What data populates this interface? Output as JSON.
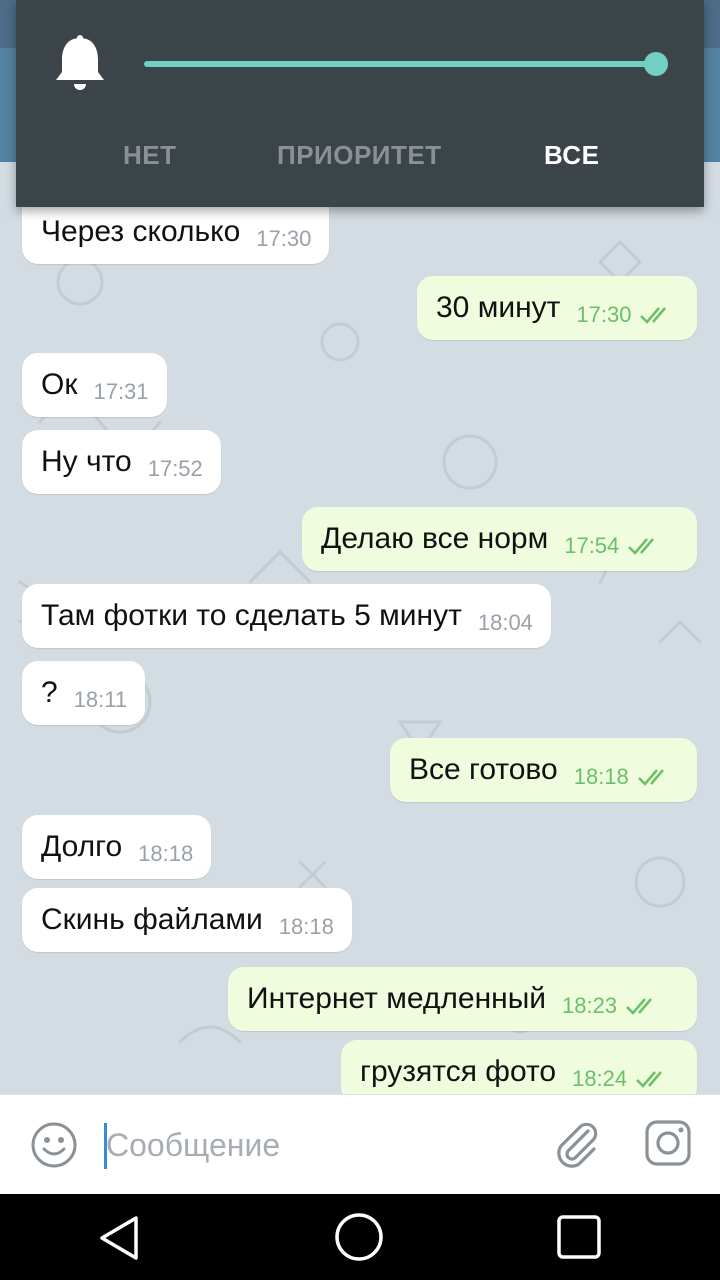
{
  "notification_popup": {
    "options": [
      "НЕТ",
      "ПРИОРИТЕТ",
      "ВСЕ"
    ],
    "selected": "ВСЕ",
    "slider_level": 1.0,
    "accent_color": "#72cfc2",
    "icon": "bell-icon"
  },
  "messages": [
    {
      "direction": "in",
      "text": "Через сколько",
      "time": "17:30"
    },
    {
      "direction": "out",
      "text": "30 минут",
      "time": "17:30",
      "status": "read"
    },
    {
      "direction": "in",
      "text": "Ок",
      "time": "17:31"
    },
    {
      "direction": "in",
      "text": "Ну что",
      "time": "17:52"
    },
    {
      "direction": "out",
      "text": "Делаю все норм",
      "time": "17:54",
      "status": "read"
    },
    {
      "direction": "in",
      "text": "Там фотки то сделать 5 минут",
      "time": "18:04"
    },
    {
      "direction": "in",
      "text": "?",
      "time": "18:11"
    },
    {
      "direction": "out",
      "text": "Все готово",
      "time": "18:18",
      "status": "read"
    },
    {
      "direction": "in",
      "text": "Долго",
      "time": "18:18"
    },
    {
      "direction": "in",
      "text": "Скинь файлами",
      "time": "18:18"
    },
    {
      "direction": "out",
      "text": "Интернет медленный",
      "time": "18:23",
      "status": "read"
    },
    {
      "direction": "out",
      "text": "грузятся фото",
      "time": "18:24",
      "status": "read"
    }
  ],
  "input": {
    "placeholder": "Сообщение",
    "value": ""
  },
  "icons": {
    "emoji": "emoji-icon",
    "attach": "paperclip-icon",
    "camera": "camera-icon"
  },
  "colors": {
    "incoming_bubble": "#ffffff",
    "outgoing_bubble": "#effdde",
    "outgoing_time": "#6cbf69",
    "popup_bg": "#3b4449"
  }
}
